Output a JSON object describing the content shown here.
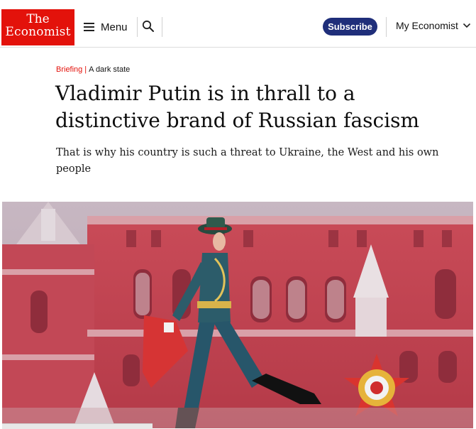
{
  "header": {
    "logo": {
      "line1": "The",
      "line2": "Economist"
    },
    "menu_label": "Menu",
    "subscribe_label": "Subscribe",
    "account_label": "My Economist"
  },
  "article": {
    "section": "Briefing",
    "separator": "|",
    "kicker": "A dark state",
    "headline": "Vladimir Putin is in thrall to a distinctive brand of Russian fascism",
    "standfirst": "That is why his country is such a threat to Ukraine, the West and his own people"
  },
  "colors": {
    "brand_red": "#e3120b",
    "subscribe_navy": "#1f2e7a"
  },
  "icons": [
    "menu-icon",
    "search-icon",
    "chevron-down-icon"
  ]
}
